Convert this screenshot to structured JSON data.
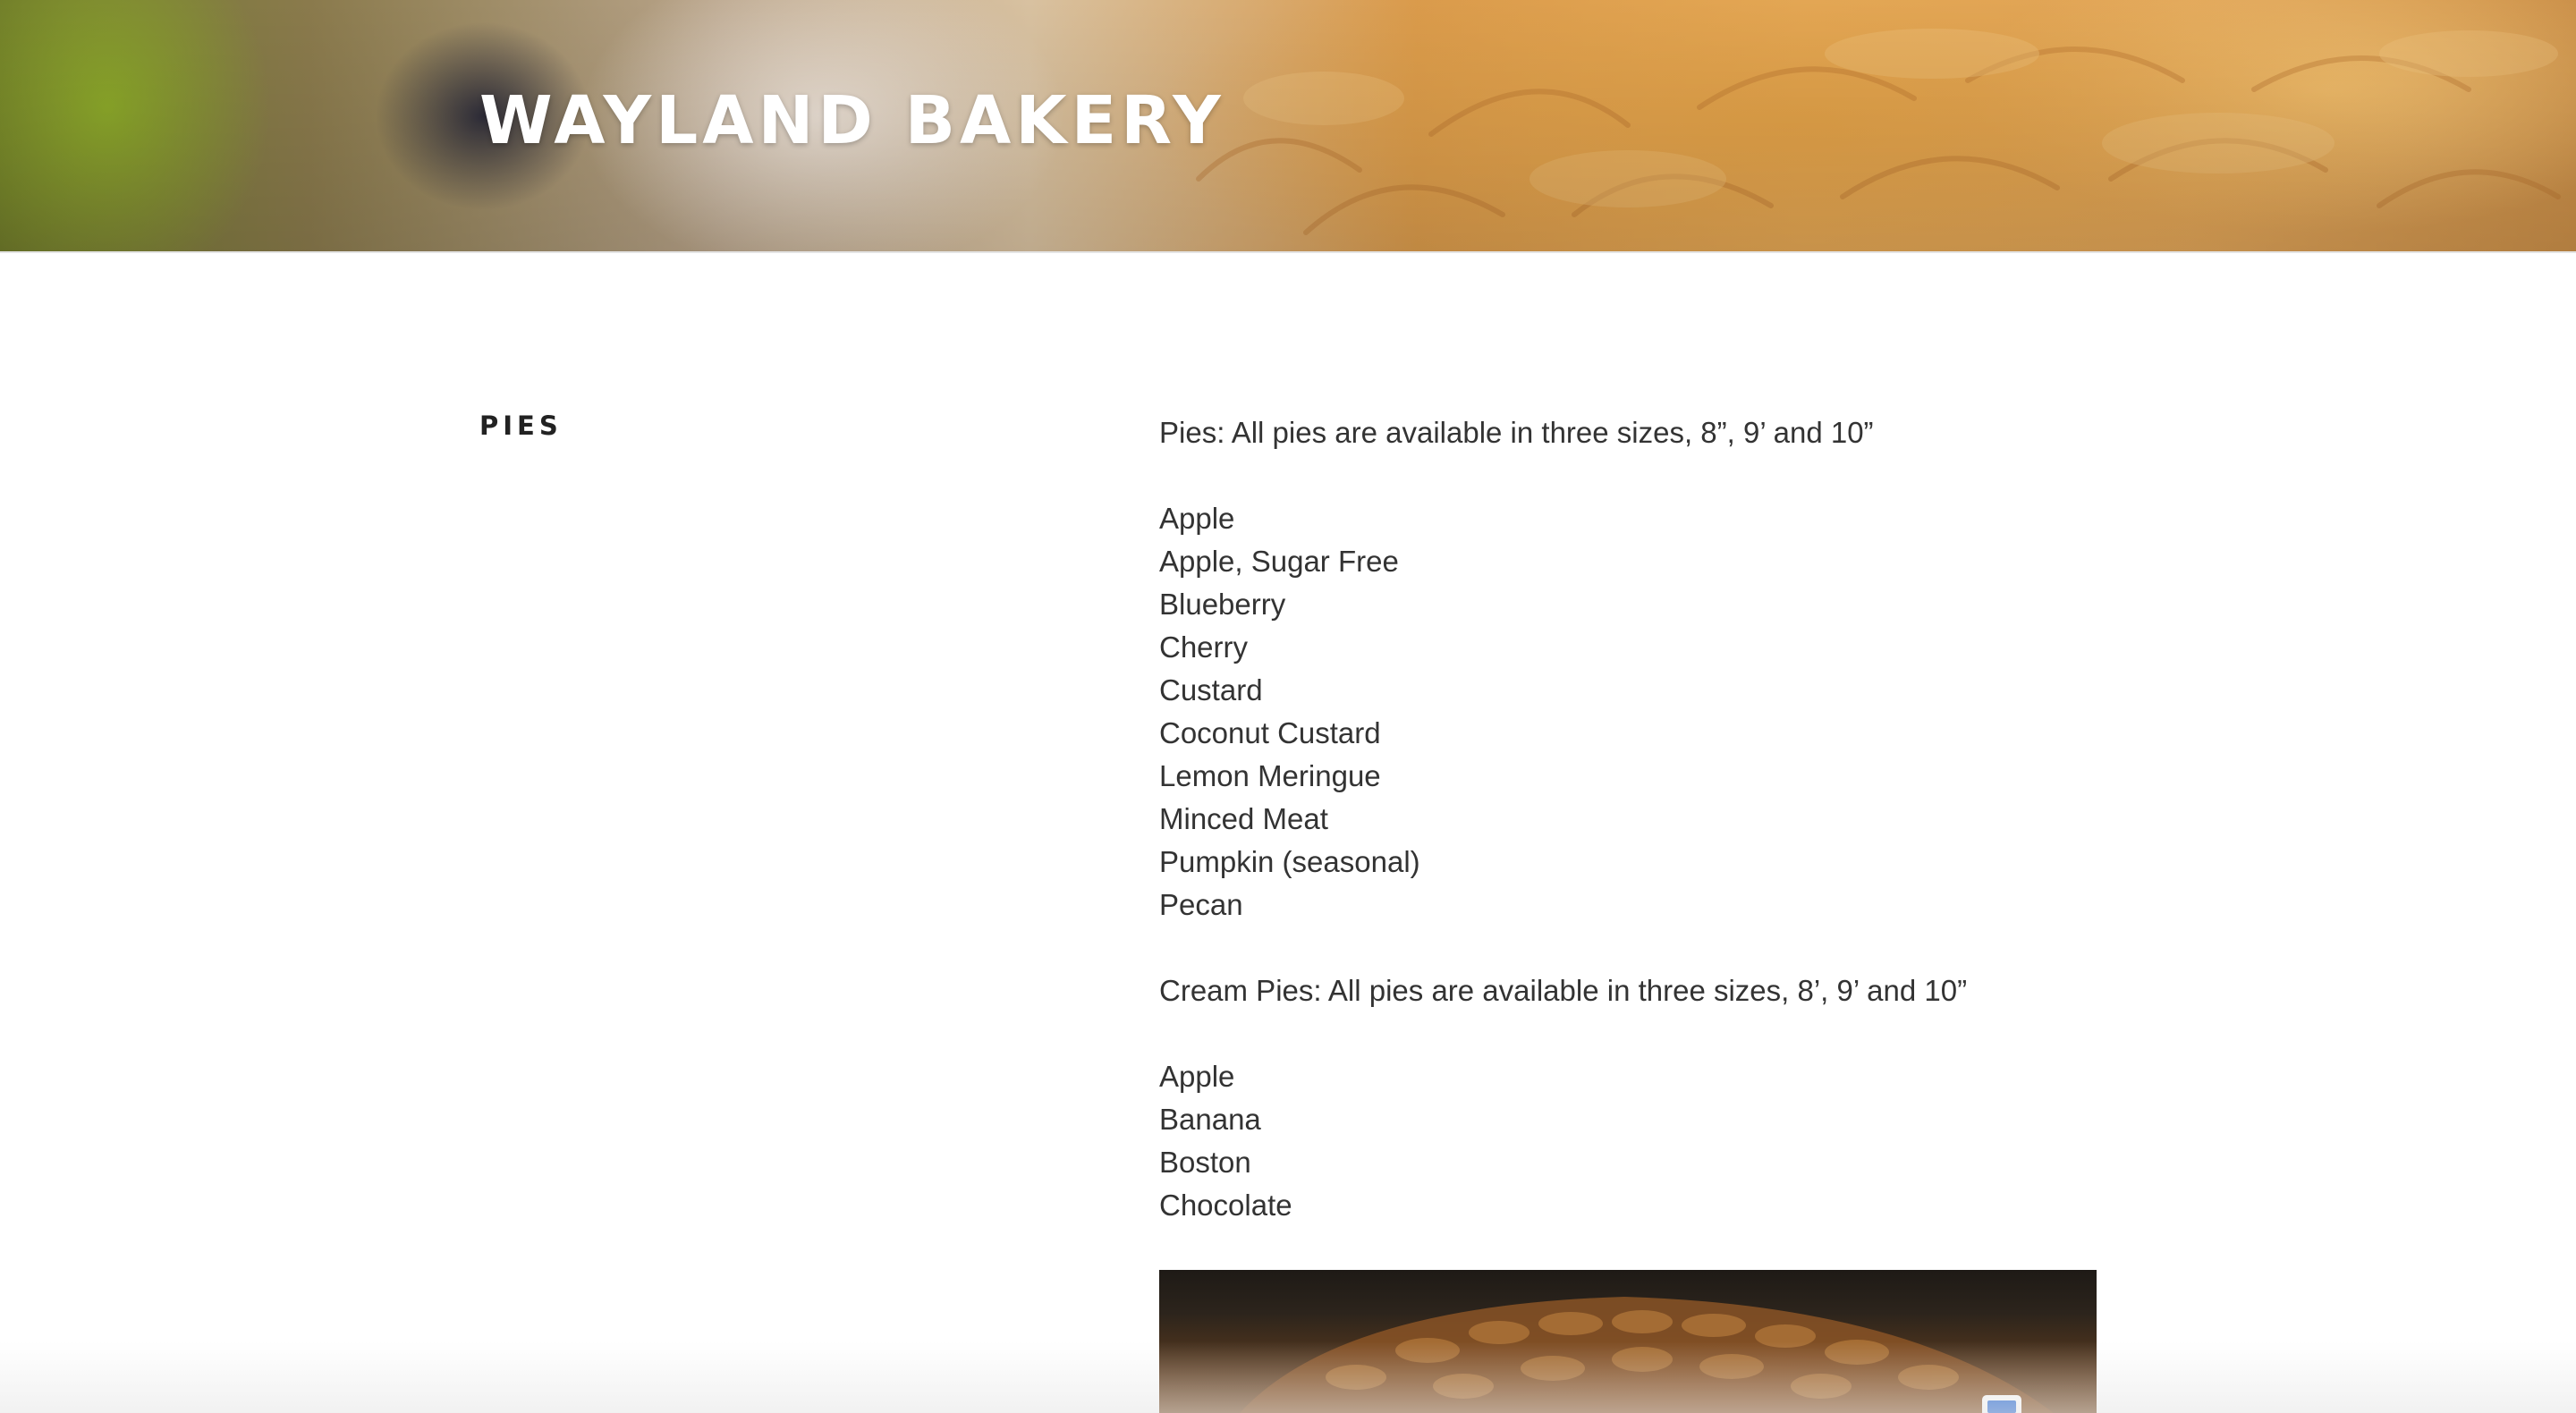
{
  "site": {
    "title": "WAYLAND BAKERY"
  },
  "section": {
    "heading": "PIES"
  },
  "content": {
    "pies_intro": "Pies: All pies are available in three sizes, 8”, 9’ and 10”",
    "pies": [
      "Apple",
      "Apple, Sugar Free",
      "Blueberry",
      "Cherry",
      "Custard",
      "Coconut Custard",
      "Lemon Meringue",
      "Minced Meat",
      "Pumpkin (seasonal)",
      "Pecan"
    ],
    "cream_pies_intro": "Cream Pies: All pies are available in three sizes, 8’, 9’ and 10”",
    "cream_pies": [
      "Apple",
      "Banana",
      "Boston",
      "Chocolate"
    ]
  },
  "images": {
    "header_image": "fruit-tart-banner",
    "pie_image": "pecan-pie-photo"
  },
  "colors": {
    "title": "#ffffff",
    "body_text": "#333333",
    "heading_text": "#222222",
    "badge_accent": "#2f6fd6"
  }
}
